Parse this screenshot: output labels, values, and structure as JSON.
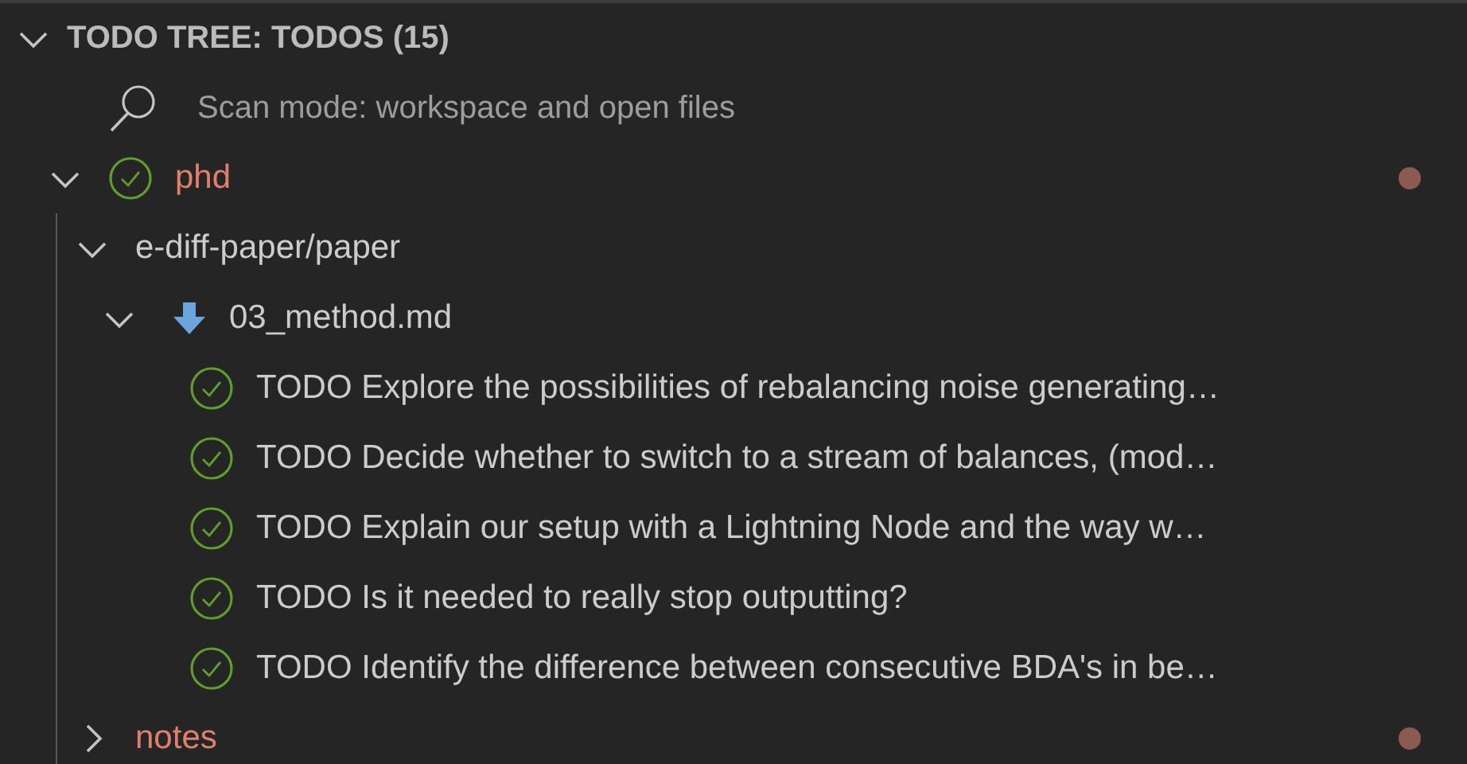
{
  "panel": {
    "title": "TODO TREE: TODOS (15)",
    "expanded": true
  },
  "scan_mode": {
    "text": "Scan mode: workspace and open files"
  },
  "tree": [
    {
      "kind": "workspace",
      "label": "phd",
      "expanded": true,
      "modified": true,
      "children": [
        {
          "kind": "folder",
          "label": "e-diff-paper/paper",
          "expanded": true,
          "children": [
            {
              "kind": "file",
              "label": "03_method.md",
              "expanded": true,
              "children": [
                {
                  "kind": "todo",
                  "label": "TODO Explore the possibilities of rebalancing noise generating…"
                },
                {
                  "kind": "todo",
                  "label": "TODO Decide whether to switch to a stream of balances, (mod…"
                },
                {
                  "kind": "todo",
                  "label": "TODO Explain our setup with a Lightning Node and the way w…"
                },
                {
                  "kind": "todo",
                  "label": "TODO Is it needed to really stop outputting?"
                },
                {
                  "kind": "todo",
                  "label": "TODO Identify the difference between consecutive BDA's in be…"
                }
              ]
            }
          ]
        },
        {
          "kind": "workspace",
          "label": "notes",
          "expanded": false,
          "modified": true
        }
      ]
    }
  ]
}
